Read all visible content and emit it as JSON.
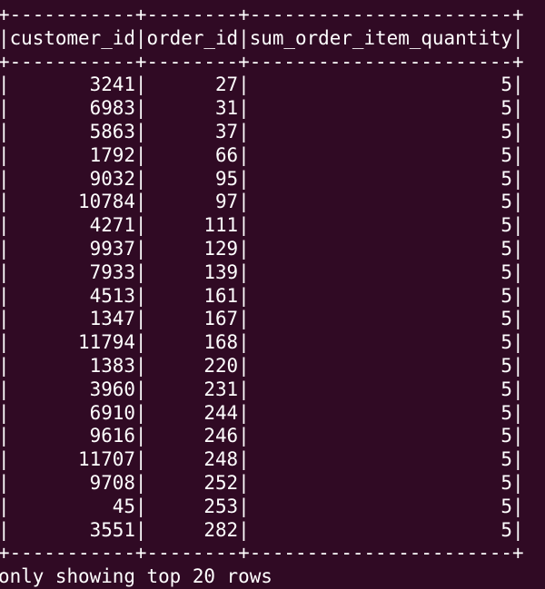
{
  "terminal": {
    "border_top": "+-----------+--------+-----------------------+",
    "header_line": "|customer_id|order_id|sum_order_item_quantity|",
    "border_mid": "+-----------+--------+-----------------------+",
    "rows": [
      "|       3241|      27|                      5|",
      "|       6983|      31|                      5|",
      "|       5863|      37|                      5|",
      "|       1792|      66|                      5|",
      "|       9032|      95|                      5|",
      "|      10784|      97|                      5|",
      "|       4271|     111|                      5|",
      "|       9937|     129|                      5|",
      "|       7933|     139|                      5|",
      "|       4513|     161|                      5|",
      "|       1347|     167|                      5|",
      "|      11794|     168|                      5|",
      "|       1383|     220|                      5|",
      "|       3960|     231|                      5|",
      "|       6910|     244|                      5|",
      "|       9616|     246|                      5|",
      "|      11707|     248|                      5|",
      "|       9708|     252|                      5|",
      "|         45|     253|                      5|",
      "|       3551|     282|                      5|"
    ],
    "border_bottom": "+-----------+--------+-----------------------+",
    "footer": "only showing top 20 rows"
  },
  "colors": {
    "background": "#300a24",
    "text": "#ffffff"
  }
}
